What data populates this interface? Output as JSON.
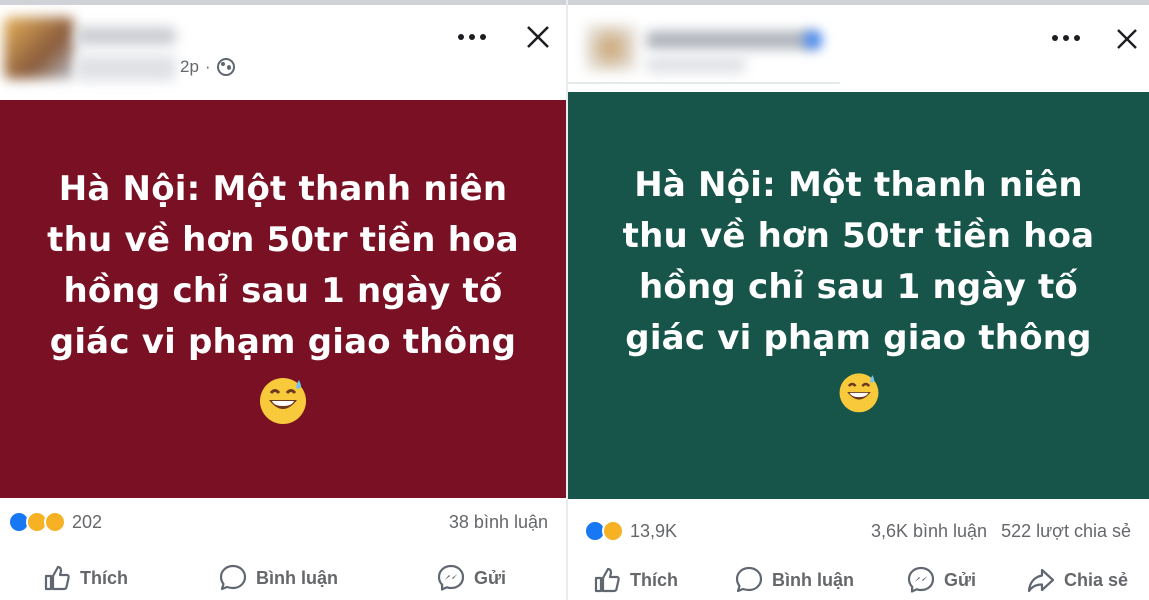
{
  "left_post": {
    "time": "2p",
    "banner_text": "Hà Nội: Một thanh niên\nthu về hơn 50tr tiền hoa\nhồng chỉ sau 1 ngày tố\ngiác vi phạm giao thông",
    "banner_color": "#7a1024",
    "reaction_count": "202",
    "comments": "38 bình luận",
    "actions": {
      "like": "Thích",
      "comment": "Bình luận",
      "send": "Gửi"
    }
  },
  "right_post": {
    "banner_text": "Hà Nội: Một thanh niên\nthu về hơn 50tr tiền hoa\nhồng chỉ sau 1 ngày tố\ngiác vi phạm giao thông",
    "banner_color": "#17554a",
    "reaction_count": "13,9K",
    "comments": "3,6K bình luận",
    "shares": "522 lượt chia sẻ",
    "actions": {
      "like": "Thích",
      "comment": "Bình luận",
      "send": "Gửi",
      "share": "Chia sẻ"
    }
  },
  "icons": [
    "more-options-icon",
    "close-icon",
    "globe-icon",
    "sweat-smile-emoji-icon",
    "like-reaction-icon",
    "haha-reaction-icon",
    "wow-reaction-icon",
    "thumbs-up-icon",
    "comment-bubble-icon",
    "messenger-icon",
    "share-arrow-icon"
  ],
  "colors": {
    "like_blue": "#1877f2",
    "reaction_yellow": "#f7b125",
    "text_gray": "#65676b"
  }
}
